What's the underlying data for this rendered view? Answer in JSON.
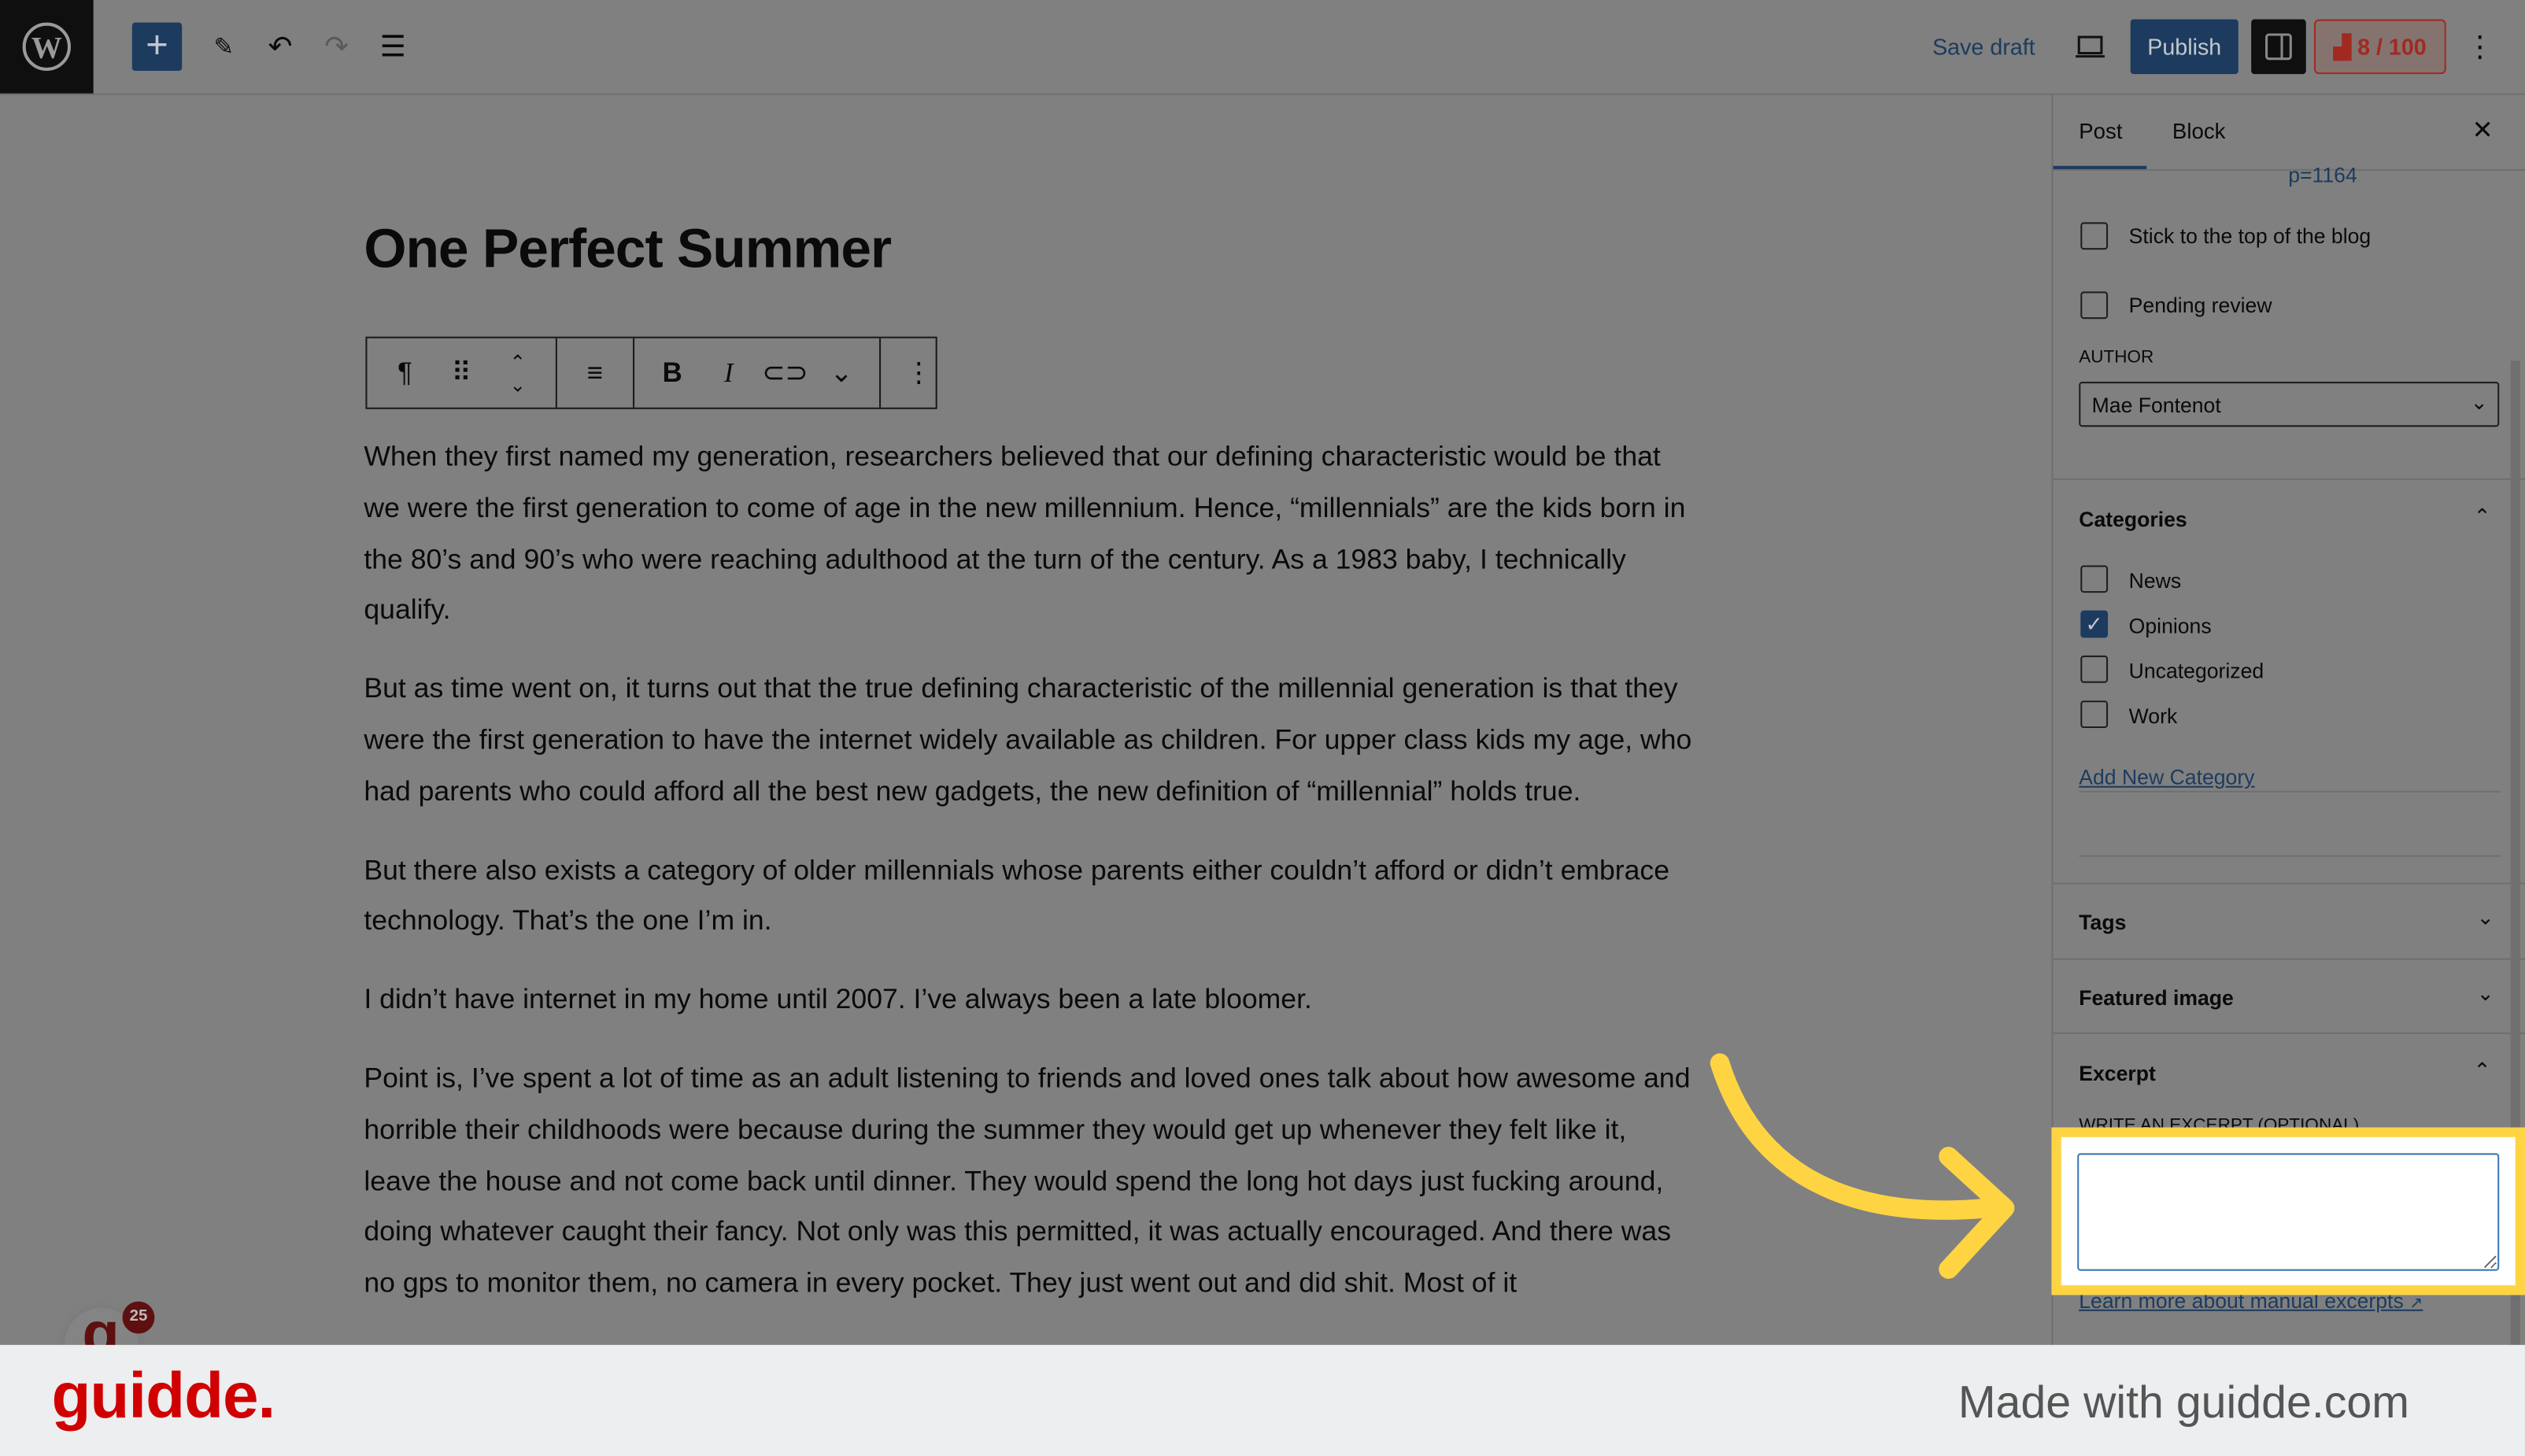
{
  "topbar": {
    "save_draft": "Save draft",
    "publish": "Publish",
    "score": "8 / 100",
    "colors": {
      "accent": "#1c3b5e",
      "score": "#a12a20"
    }
  },
  "post": {
    "title": "One Perfect Summer",
    "paragraphs": [
      "When they first named my generation, researchers believed that our defining characteristic would be that we were the first generation to come of age in the new millennium. Hence, “millennials” are the kids born in the 80’s and 90’s who were reaching adulthood at the turn of the century. As a 1983 baby, I technically qualify.",
      "But as time went on, it turns out that the true defining characteristic of the millennial generation is that they were the first generation to have the internet widely available as children. For upper class kids my age, who had parents who could afford all the best new gadgets, the new definition of “millennial” holds true.",
      "But there also exists a category of older millennials whose parents either couldn’t afford or didn’t embrace technology. That’s the one I’m in.",
      "I didn’t have internet in my home until 2007. I’ve always been a late bloomer.",
      "Point is, I’ve spent a lot of time as an adult listening to friends and loved ones talk about how awesome and horrible their childhoods were because during the summer they would get up whenever they felt like it, leave the house and not come back until dinner. They would spend the long hot days just fucking around, doing whatever caught their fancy. Not only was this permitted, it was actually encouraged. And there was no gps to monitor them, no camera in every pocket. They just went out and did shit. Most of it"
    ]
  },
  "sidebar": {
    "tabs": [
      "Post",
      "Block"
    ],
    "permalink": "p=1164",
    "stick": "Stick to the top of the blog",
    "pending": "Pending review",
    "author_label": "AUTHOR",
    "author": "Mae Fontenot",
    "categories_title": "Categories",
    "categories": [
      {
        "label": "News",
        "checked": false
      },
      {
        "label": "Opinions",
        "checked": true
      },
      {
        "label": "Uncategorized",
        "checked": false
      },
      {
        "label": "Work",
        "checked": false
      }
    ],
    "add_category": "Add New Category",
    "tags": "Tags",
    "featured": "Featured image",
    "excerpt": "Excerpt",
    "excerpt_label": "WRITE AN EXCERPT (OPTIONAL)",
    "excerpt_value": "",
    "learn_more": "Learn more about manual excerpts"
  },
  "widget": {
    "badge": "25"
  },
  "footer": {
    "logo": "guidde.",
    "made_with": "Made with guidde.com"
  },
  "highlight_color": "#ffd443"
}
